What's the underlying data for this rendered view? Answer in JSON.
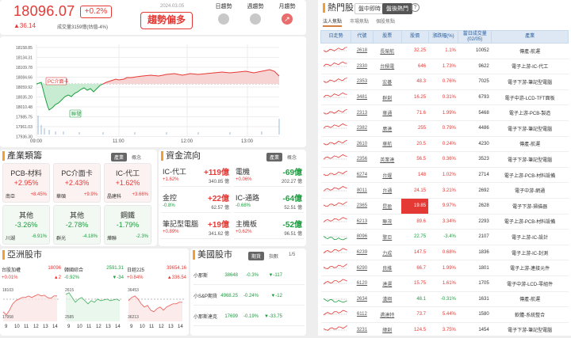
{
  "quote": {
    "price": "18096.07",
    "pct": "+0.2%",
    "change": "▲36.14",
    "volume": "成交量3159億(估值-4%)",
    "date": "2024.03.05",
    "trend": "趨勢偏多"
  },
  "trend_buttons": [
    {
      "label": "日趨勢"
    },
    {
      "label": "週趨勢"
    },
    {
      "label": "月趨勢"
    }
  ],
  "main_chart": {
    "y_ticks": [
      "18158.85",
      "18134.31",
      "18109.78",
      "18084.66",
      "18059.92",
      "18035.20",
      "18010.48",
      "17985.75",
      "17961.03",
      "17936.30"
    ],
    "x_ticks": [
      "09:00",
      "11:00",
      "12:00",
      "13:00"
    ],
    "tag_prev": "PC介面卡",
    "tag_label": "聯發"
  },
  "industry": {
    "title": "產業類籌",
    "toggle": [
      "產業",
      "概念"
    ],
    "items": [
      {
        "name": "PCB-材料",
        "pct": "+2.95%",
        "sub_name": "南亞",
        "sub_pct": "+8.45%",
        "dir": "up"
      },
      {
        "name": "PC介面卡",
        "pct": "+2.43%",
        "sub_name": "華碩",
        "sub_pct": "+9.9%",
        "dir": "up"
      },
      {
        "name": "IC-代工",
        "pct": "+1.62%",
        "sub_name": "晶建科",
        "sub_pct": "+3.66%",
        "dir": "up"
      },
      {
        "name": "其他",
        "pct": "-3.26%",
        "sub_name": "川湖",
        "sub_pct": "-6.91%",
        "dir": "dn"
      },
      {
        "name": "其他",
        "pct": "-2.78%",
        "sub_name": "群光",
        "sub_pct": "-4.18%",
        "dir": "dn"
      },
      {
        "name": "鋼鐵",
        "pct": "-1.79%",
        "sub_name": "燁聯",
        "sub_pct": "-2.3%",
        "dir": "dn"
      }
    ]
  },
  "flow": {
    "title": "資金流向",
    "toggle": [
      "產業",
      "概念"
    ],
    "items": [
      {
        "name": "IC-代工",
        "val": "+119億",
        "pct": "+1.62%",
        "amt": "340.85 億",
        "dir": "up"
      },
      {
        "name": "電機",
        "val": "-69億",
        "pct": "+0.06%",
        "amt": "202.27 億",
        "dir": "dn"
      },
      {
        "name": "金控",
        "val": "+22億",
        "pct": "-0.8%",
        "amt": "62.57 億",
        "dir": "up"
      },
      {
        "name": "IC-通路",
        "val": "-64億",
        "pct": "-0.68%",
        "amt": "52.51 億",
        "dir": "dn"
      },
      {
        "name": "筆記型電腦",
        "val": "+19億",
        "pct": "+0.89%",
        "amt": "341.62 億",
        "dir": "up"
      },
      {
        "name": "主機板",
        "val": "-52億",
        "pct": "+0.62%",
        "amt": "96.51 億",
        "dir": "dn"
      }
    ]
  },
  "asia": {
    "title": "亞洲股市",
    "markets": [
      {
        "name": "台股加權",
        "price": "18096",
        "pct": "+0.01%",
        "chg": "▲2",
        "dir": "up",
        "lo": "17958",
        "hi": "18103",
        "x": [
          "9",
          "10",
          "11",
          "12",
          "13",
          "14"
        ]
      },
      {
        "name": "韓國綜合",
        "price": "2591.31",
        "pct": "-0.92%",
        "chg": "▼-34",
        "dir": "dn",
        "lo": "2585",
        "hi": "2615",
        "x": [
          "9",
          "10",
          "11",
          "12",
          "13",
          "14"
        ]
      },
      {
        "name": "日經225",
        "price": "39654.16",
        "pct": "+0.84%",
        "chg": "▲336.54",
        "dir": "up",
        "lo": "36213",
        "hi": "36453",
        "x": [
          "9",
          "10",
          "11",
          "12",
          "13",
          "14"
        ]
      }
    ]
  },
  "us": {
    "title": "美國股市",
    "toggle": [
      "期貨",
      "指數"
    ],
    "page": "1/5",
    "rows": [
      {
        "name": "小那斯",
        "price": "38648",
        "pct": "-0.3%",
        "chg": "▼-117"
      },
      {
        "name": "小S&P期貨",
        "price": "4968.25",
        "pct": "-0.24%",
        "chg": "▼-12"
      },
      {
        "name": "小那斯達克",
        "price": "17699",
        "pct": "-0.19%",
        "chg": "▼-33.75"
      }
    ]
  },
  "hot": {
    "title": "熱門股",
    "tabs": [
      "盤中即時",
      "盤後熱門"
    ],
    "subtabs": [
      "法人焦點",
      "市場焦點",
      "個股焦點"
    ],
    "headers": [
      "日走勢",
      "代號",
      "股票",
      "股價",
      "漲跌幅(%)",
      "當日成交量(02/05)",
      "產業"
    ],
    "rows": [
      {
        "code": "2618",
        "name": "長榮航",
        "price": "32.25",
        "pct": "1.1%",
        "vol": "10052",
        "ind": "傳產-航運",
        "hl": false
      },
      {
        "code": "2330",
        "name": "台積電",
        "price": "646",
        "pct": "1.73%",
        "vol": "9622",
        "ind": "電子上游-IC-代工",
        "hl": false
      },
      {
        "code": "2353",
        "name": "宏碁",
        "price": "48.3",
        "pct": "0.76%",
        "vol": "7025",
        "ind": "電子下游-筆記型電腦",
        "hl": false
      },
      {
        "code": "3481",
        "name": "群創",
        "price": "16.25",
        "pct": "0.31%",
        "vol": "6793",
        "ind": "電子中游-LCD-TFT面板",
        "hl": false
      },
      {
        "code": "2313",
        "name": "華通",
        "price": "71.6",
        "pct": "1.99%",
        "vol": "5468",
        "ind": "電子上游-PCB-製造",
        "hl": false
      },
      {
        "code": "2382",
        "name": "廣達",
        "price": "255",
        "pct": "0.79%",
        "vol": "4486",
        "ind": "電子下游-筆記型電腦",
        "hl": false
      },
      {
        "code": "2610",
        "name": "華航",
        "price": "20.5",
        "pct": "0.24%",
        "vol": "4230",
        "ind": "傳產-航運",
        "hl": false
      },
      {
        "code": "2356",
        "name": "英業達",
        "price": "56.5",
        "pct": "0.36%",
        "vol": "3523",
        "ind": "電子下游-筆記型電腦",
        "hl": false
      },
      {
        "code": "6274",
        "name": "台燿",
        "price": "148",
        "pct": "1.02%",
        "vol": "2714",
        "ind": "電子上游-PCB-材料設備",
        "hl": false
      },
      {
        "code": "8011",
        "name": "台通",
        "price": "24.15",
        "pct": "3.21%",
        "vol": "2692",
        "ind": "電子中游-網通",
        "hl": false
      },
      {
        "code": "2365",
        "name": "昆盈",
        "price": "19.85",
        "pct": "9.97%",
        "vol": "2628",
        "ind": "電子下游-掃描器",
        "hl": true
      },
      {
        "code": "6213",
        "name": "聯茂",
        "price": "89.6",
        "pct": "3.34%",
        "vol": "2293",
        "ind": "電子上游-PCB-材料設備",
        "hl": false
      },
      {
        "code": "8096",
        "name": "擎亞",
        "price": "22.75",
        "pct": "-3.4%",
        "vol": "2107",
        "ind": "電子上游-IC-設計",
        "hl": false
      },
      {
        "code": "6239",
        "name": "力成",
        "price": "147.5",
        "pct": "0.68%",
        "vol": "1836",
        "ind": "電子上游-IC-封測",
        "hl": false
      },
      {
        "code": "6290",
        "name": "良維",
        "price": "66.7",
        "pct": "1.99%",
        "vol": "1801",
        "ind": "電子上游-連接元件",
        "hl": false
      },
      {
        "code": "6120",
        "name": "達運",
        "price": "15.75",
        "pct": "1.61%",
        "vol": "1705",
        "ind": "電子中游-LCD-零組件",
        "hl": false
      },
      {
        "code": "2634",
        "name": "漢翔",
        "price": "48.1",
        "pct": "-0.31%",
        "vol": "1631",
        "ind": "傳產-航運",
        "hl": false
      },
      {
        "code": "6112",
        "name": "邁達特",
        "price": "73.7",
        "pct": "5.44%",
        "vol": "1580",
        "ind": "軟體-系統整合",
        "hl": false
      },
      {
        "code": "3231",
        "name": "緯創",
        "price": "124.5",
        "pct": "3.75%",
        "vol": "1454",
        "ind": "電子下游-筆記型電腦",
        "hl": false
      }
    ]
  }
}
